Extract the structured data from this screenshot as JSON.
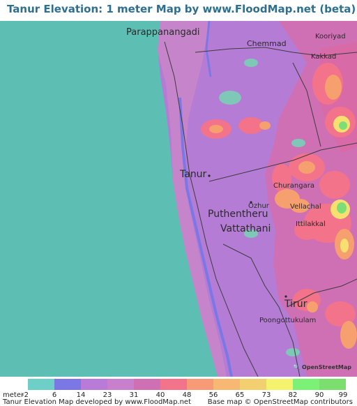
{
  "title": "Tanur Elevation: 1 meter Map by www.FloodMap.net (beta)",
  "colors": {
    "sea": "#5dbfb4",
    "lowland": "#b57cd6",
    "lowland_light": "#cc86c8",
    "water_channel": "#7b78e6",
    "mid": "#d070b4",
    "high": "#f2738a",
    "higher": "#f7a06f",
    "peak": "#f2e070",
    "top": "#7dde75",
    "road": "#3c3c3c",
    "title": "#2e6e8e"
  },
  "places": [
    {
      "name": "Parappanangadi"
    },
    {
      "name": "Chemmad"
    },
    {
      "name": "Kooriyad"
    },
    {
      "name": "Kakkad"
    },
    {
      "name": "Tanur"
    },
    {
      "name": "Churangara"
    },
    {
      "name": "Ozhur"
    },
    {
      "name": "Vellachal"
    },
    {
      "name": "Puthentheru"
    },
    {
      "name": "Ittilakkal"
    },
    {
      "name": "Vattathani"
    },
    {
      "name": "Tirur"
    },
    {
      "name": "Poongottukulam"
    }
  ],
  "legend": {
    "unit_label": "meter",
    "ticks": [
      "-2",
      "6",
      "14",
      "23",
      "31",
      "40",
      "48",
      "56",
      "65",
      "73",
      "82",
      "90",
      "99"
    ],
    "colors": [
      "#6ecfc8",
      "#7b78e6",
      "#b87bd8",
      "#c880cc",
      "#d070b4",
      "#f2738a",
      "#f79a76",
      "#f7b874",
      "#f2d070",
      "#f5f26e",
      "#7bf276",
      "#7bde6e"
    ]
  },
  "footer": {
    "left": "Tanur Elevation Map developed by www.FloodMap.net",
    "right": "Base map © OpenStreetMap contributors"
  },
  "logo_text": "OpenStreetMap"
}
